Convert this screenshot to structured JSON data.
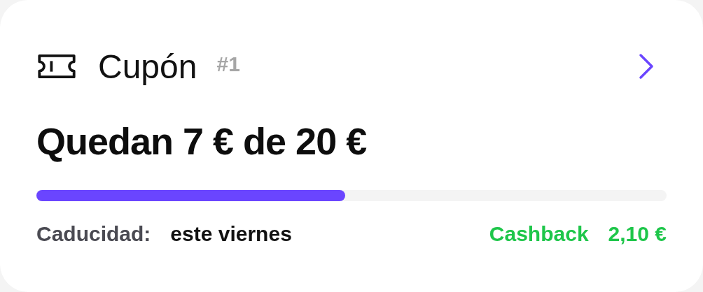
{
  "coupon": {
    "title": "Cupón",
    "number": "#1",
    "heading": "Quedan 7 € de 20 €",
    "progress": {
      "level": 0.49
    },
    "expiry_label": "Caducidad:",
    "expiry_value": "este viernes",
    "cashback_label": "Cashback",
    "cashback_value": "2,10 €"
  }
}
